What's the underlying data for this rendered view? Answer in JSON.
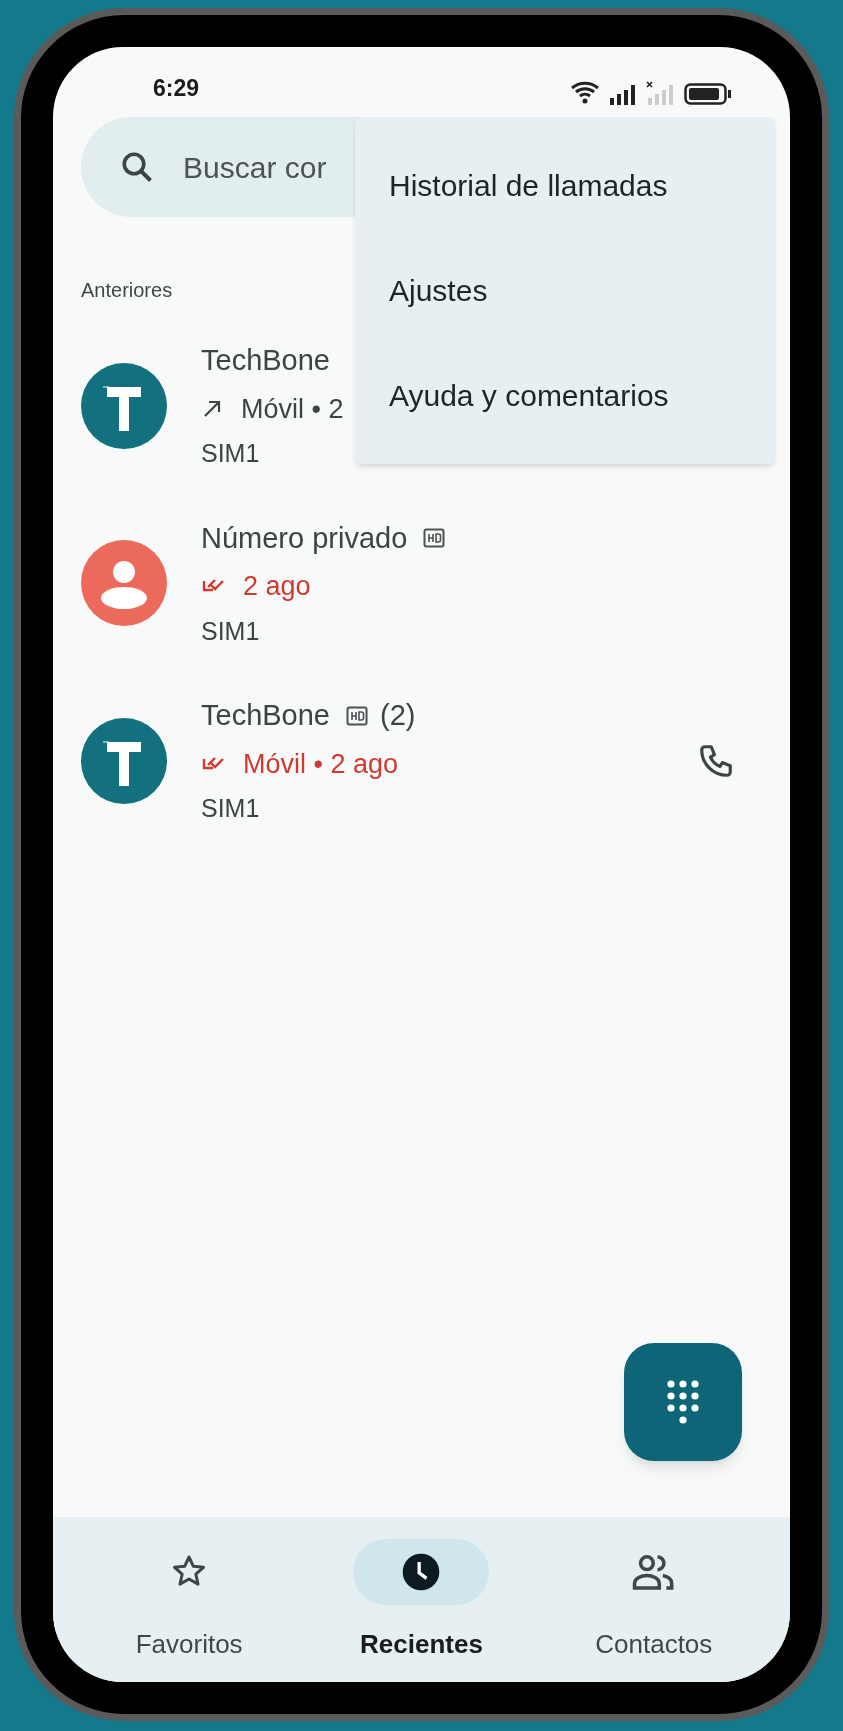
{
  "status_bar": {
    "time": "6:29"
  },
  "search": {
    "placeholder": "Buscar cor"
  },
  "menu": {
    "items": [
      {
        "label": "Historial de llamadas"
      },
      {
        "label": "Ajustes"
      },
      {
        "label": "Ayuda y comentarios"
      }
    ]
  },
  "section_label": "Anteriores",
  "calls": [
    {
      "name": "TechBone",
      "avatar": {
        "kind": "letter"
      },
      "kind": "outgoing",
      "detail": "Móvil • 2",
      "sim": "SIM1"
    },
    {
      "name": "Número privado",
      "avatar": {
        "kind": "person"
      },
      "hd": true,
      "kind": "missed",
      "detail": "2 ago",
      "sim": "SIM1",
      "call_button": false
    },
    {
      "name": "TechBone",
      "avatar": {
        "kind": "letter"
      },
      "hd": true,
      "count": "(2)",
      "kind": "missed",
      "detail": "Móvil • 2 ago",
      "sim": "SIM1",
      "call_button": true
    }
  ],
  "nav": [
    {
      "label": "Favoritos",
      "selected": false
    },
    {
      "label": "Recientes",
      "selected": true
    },
    {
      "label": "Contactos",
      "selected": false
    }
  ]
}
